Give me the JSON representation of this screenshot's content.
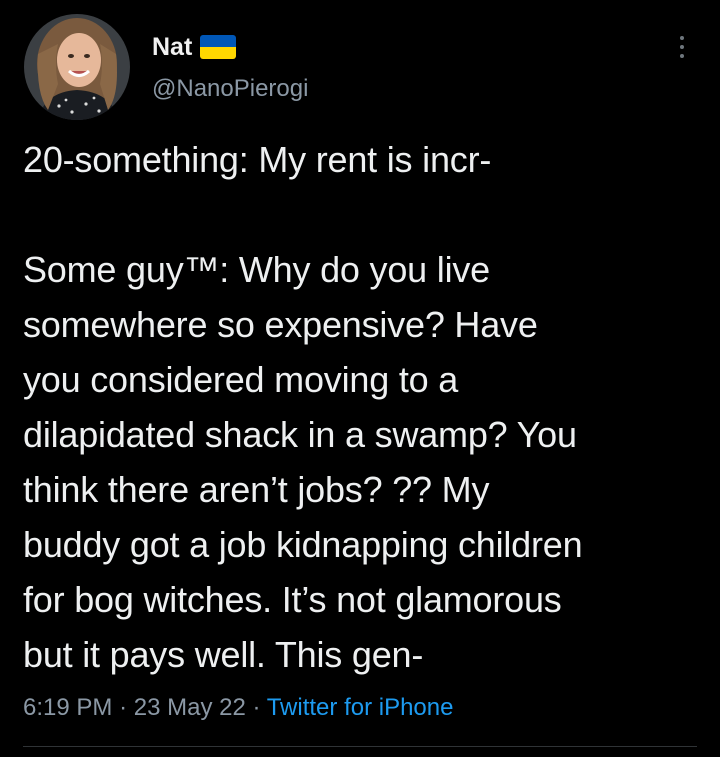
{
  "author": {
    "display_name": "Nat",
    "handle": "@NanoPierogi",
    "flag": "ukraine-flag"
  },
  "tweet": {
    "line_1": "20-something: My rent is incr-",
    "paragraph_2": [
      "Some guy™: Why do you live",
      "somewhere so expensive? Have",
      "you considered moving to a",
      "dilapidated shack in a swamp? You",
      "think there aren’t jobs? ?? My",
      "buddy got a job kidnapping children",
      "for bog witches. It’s not glamorous",
      "but it pays well. This gen-"
    ]
  },
  "meta": {
    "time": "6:19 PM",
    "separator": "·",
    "date": "23 May 22",
    "source": "Twitter for iPhone"
  },
  "colors": {
    "background": "#000000",
    "text": "#e7e9ea",
    "secondary": "#8b98a5",
    "link": "#1d9bf0",
    "flag_blue": "#0057b7",
    "flag_yellow": "#ffd700"
  },
  "icons": {
    "more": "more-options-icon"
  }
}
